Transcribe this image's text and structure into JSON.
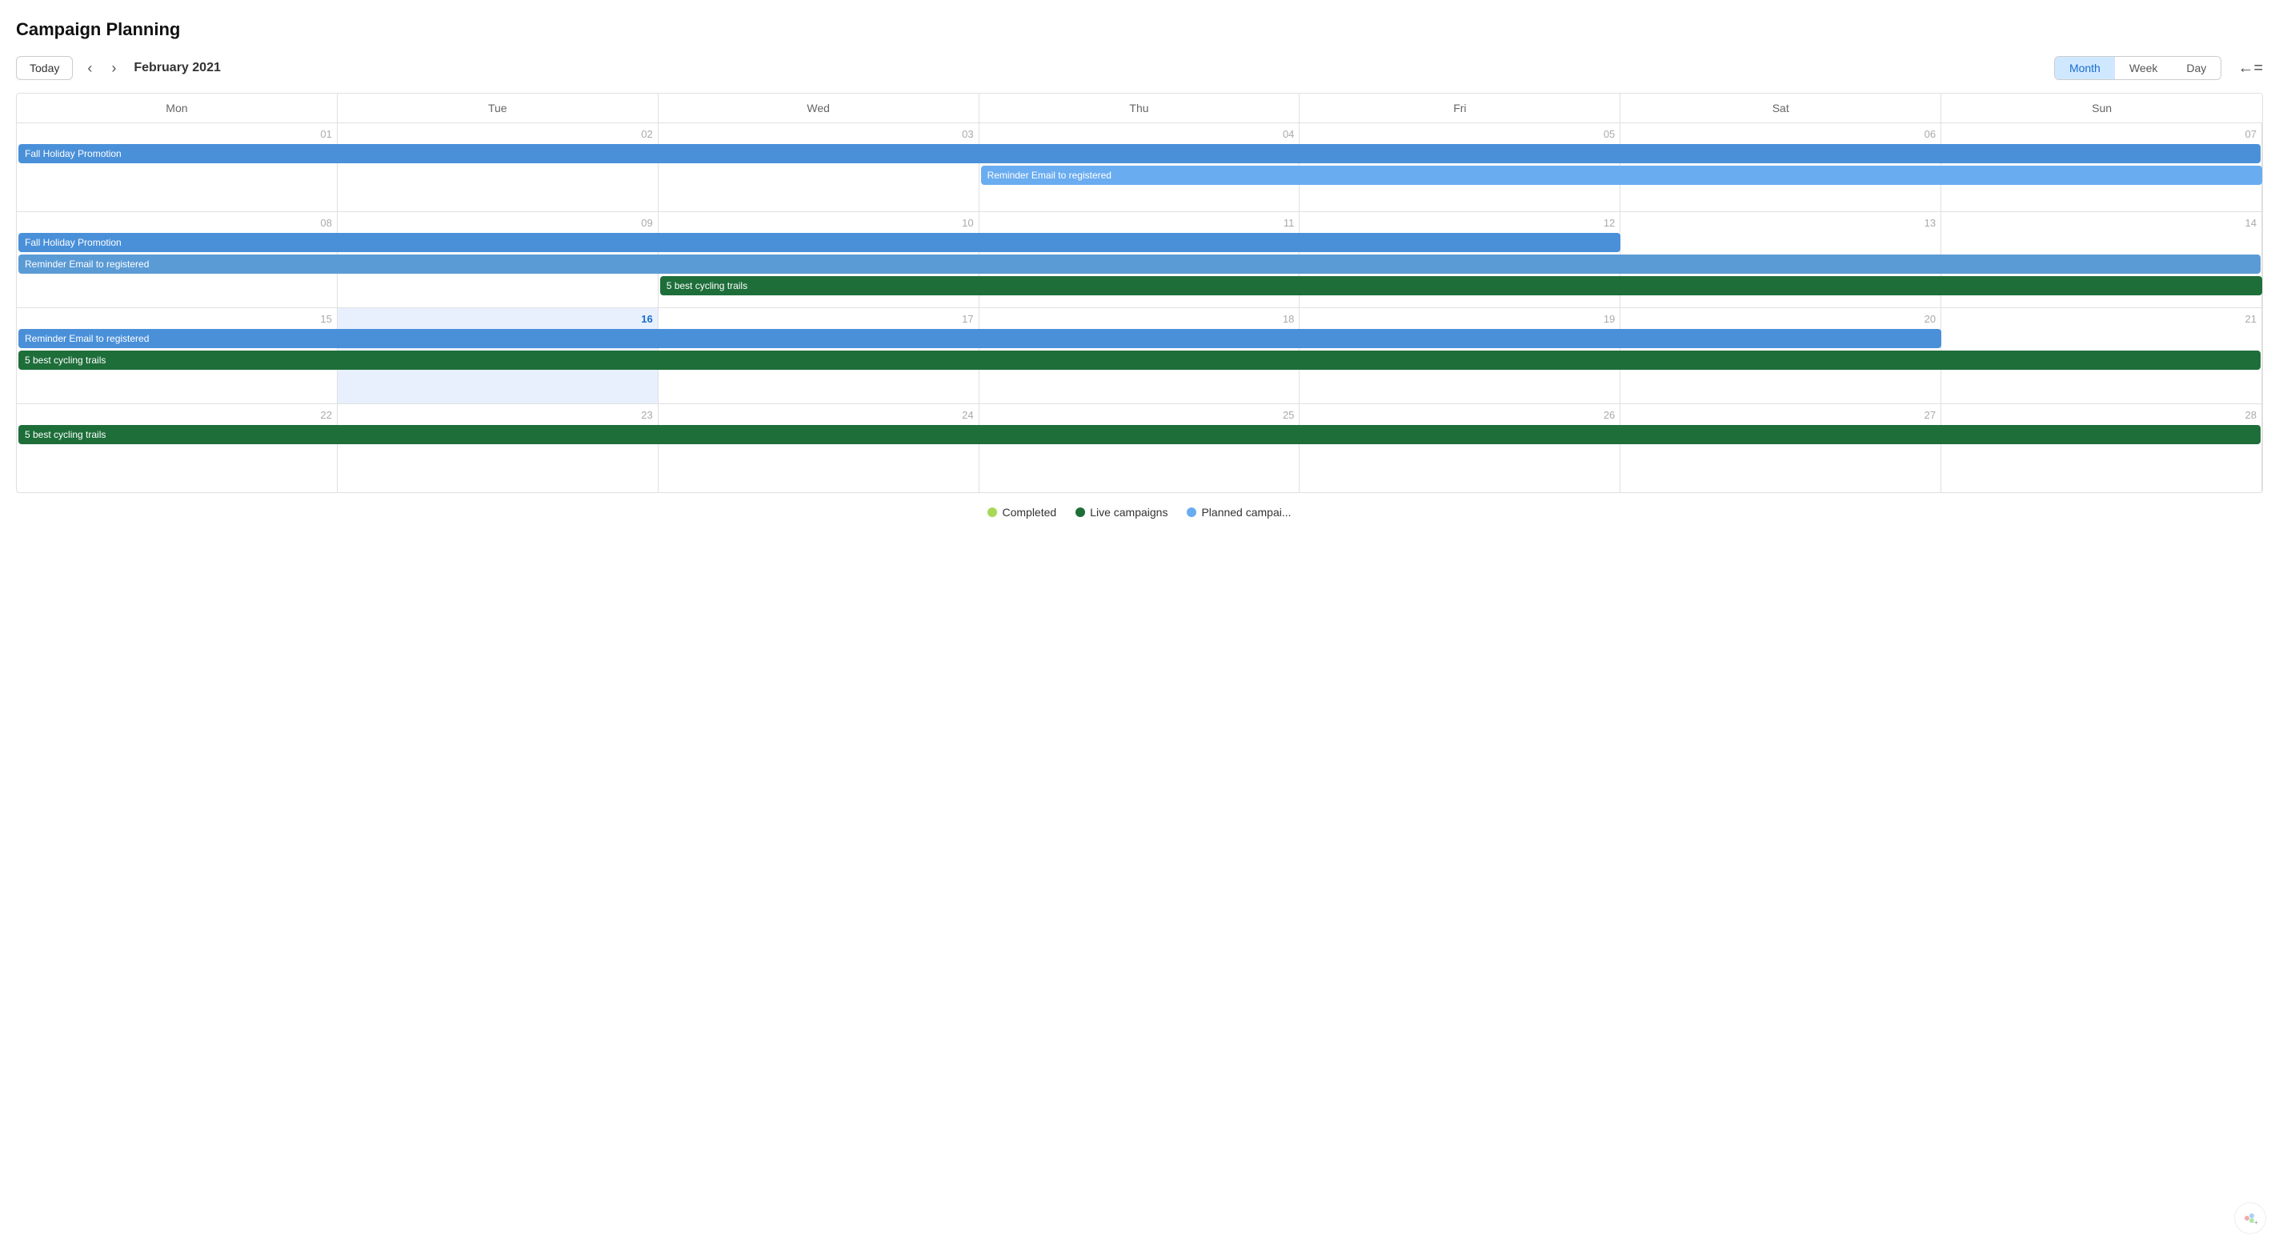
{
  "page": {
    "title": "Campaign Planning"
  },
  "toolbar": {
    "today_label": "Today",
    "month_label": "February 2021",
    "views": [
      "Month",
      "Week",
      "Day"
    ],
    "active_view": "Month"
  },
  "calendar": {
    "day_names": [
      "Mon",
      "Tue",
      "Wed",
      "Thu",
      "Fri",
      "Sat",
      "Sun"
    ],
    "weeks": [
      {
        "dates": [
          "01",
          "02",
          "03",
          "04",
          "05",
          "06",
          "07"
        ],
        "events": [
          {
            "label": "Fall Holiday Promotion",
            "color": "blue",
            "col_start": 0,
            "col_end": 7
          },
          {
            "label": "Reminder Email to registered",
            "color": "lightblue",
            "col_start": 3,
            "col_end": 7
          }
        ]
      },
      {
        "dates": [
          "08",
          "09",
          "10",
          "11",
          "12",
          "13",
          "14"
        ],
        "events": [
          {
            "label": "Fall Holiday Promotion",
            "color": "blue",
            "col_start": 0,
            "col_end": 5
          },
          {
            "label": "Reminder Email to registered",
            "color": "blue",
            "col_start": 0,
            "col_end": 7
          },
          {
            "label": "5 best cycling trails",
            "color": "green",
            "col_start": 2,
            "col_end": 7
          }
        ]
      },
      {
        "dates": [
          "15",
          "16",
          "17",
          "18",
          "19",
          "20",
          "21"
        ],
        "today_col": 1,
        "events": [
          {
            "label": "Reminder Email to registered",
            "color": "blue",
            "col_start": 0,
            "col_end": 6
          },
          {
            "label": "5 best cycling trails",
            "color": "green",
            "col_start": 0,
            "col_end": 7
          }
        ]
      },
      {
        "dates": [
          "22",
          "23",
          "24",
          "25",
          "26",
          "27",
          "28"
        ],
        "events": [
          {
            "label": "5 best cycling trails",
            "color": "green",
            "col_start": 0,
            "col_end": 7
          }
        ]
      }
    ]
  },
  "legend": {
    "items": [
      {
        "label": "Completed",
        "dot": "completed"
      },
      {
        "label": "Live campaigns",
        "dot": "live"
      },
      {
        "label": "Planned campai...",
        "dot": "planned"
      }
    ]
  }
}
